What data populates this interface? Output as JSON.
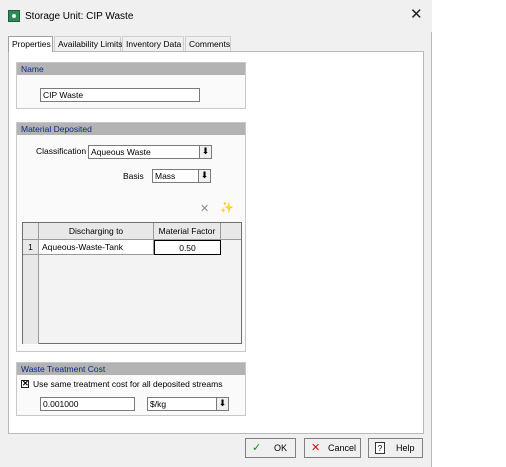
{
  "window": {
    "title": "Storage Unit: CIP Waste",
    "close_glyph": "✕"
  },
  "tabs": [
    {
      "label": "Properties",
      "active": true
    },
    {
      "label": "Availability Limits"
    },
    {
      "label": "Inventory Data"
    },
    {
      "label": "Comments"
    }
  ],
  "name_section": {
    "header": "Name",
    "value": "CIP Waste"
  },
  "material_section": {
    "header": "Material Deposited",
    "classification_label": "Classification",
    "classification_value": "Aqueous Waste",
    "basis_label": "Basis",
    "basis_value": "Mass",
    "toolbar": {
      "delete_glyph": "✕",
      "wand_glyph": "✨"
    },
    "table": {
      "columns": [
        "Discharging to",
        "Material Factor"
      ],
      "rows": [
        {
          "index": "1",
          "discharging_to": "Aqueous-Waste-Tank",
          "material_factor": "0.50"
        }
      ]
    }
  },
  "waste_section": {
    "header": "Waste Treatment Cost",
    "checkbox_label": "Use same treatment cost for all deposited streams",
    "checkbox_checked": true,
    "checkbox_glyph": "✕",
    "cost_value": "0.001000",
    "unit_value": "$/kg"
  },
  "buttons": {
    "ok": {
      "label": "OK",
      "glyph": "✓"
    },
    "cancel": {
      "label": "Cancel",
      "glyph": "✕"
    },
    "help": {
      "label": "Help",
      "glyph": "?"
    }
  },
  "colors": {
    "header_text": "#0a2a8a",
    "ok_green": "#1a8a1a",
    "cancel_red": "#d01010",
    "group_header_bg": "#b3b3b3"
  }
}
